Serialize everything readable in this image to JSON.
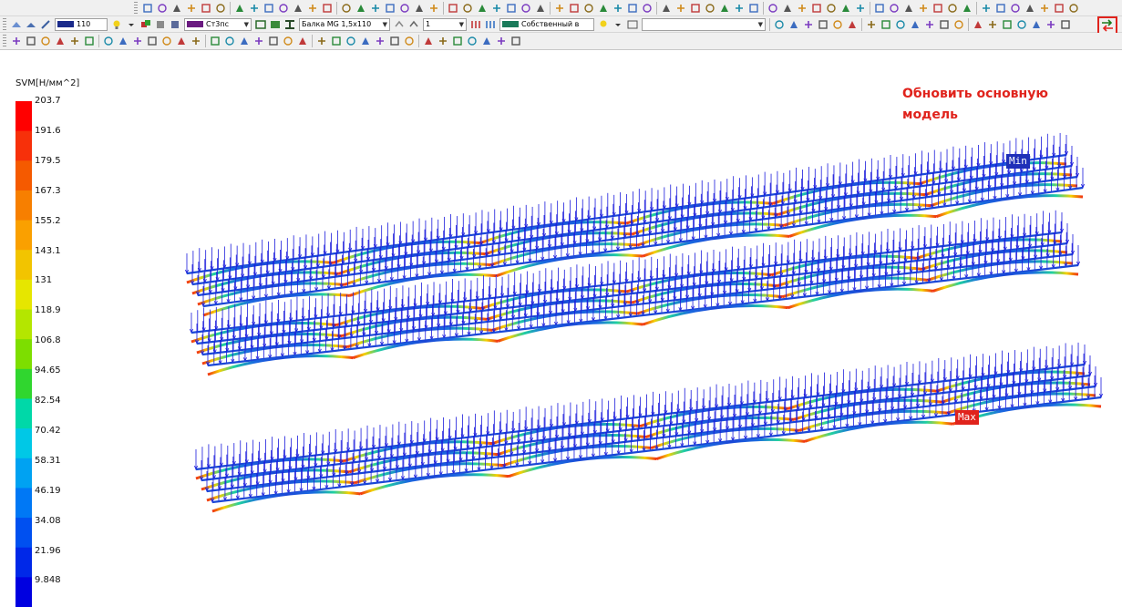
{
  "toolbar": {
    "group_number": "110",
    "material": "Ст3пс",
    "section": "Балка MG 1,5x110",
    "step": "1",
    "load_case": "Собственный в",
    "empty_combo": ""
  },
  "legend": {
    "title": "SVM[Н/мм^2]",
    "ticks": [
      "203.7",
      "191.6",
      "179.5",
      "167.3",
      "155.2",
      "143.1",
      "131",
      "118.9",
      "106.8",
      "94.65",
      "82.54",
      "70.42",
      "58.31",
      "46.19",
      "34.08",
      "21.96",
      "9.848"
    ],
    "colors": [
      "#ff0000",
      "#f7300a",
      "#f55a00",
      "#f77f00",
      "#faa000",
      "#f2c400",
      "#e6e600",
      "#b4e600",
      "#7dde00",
      "#30d62f",
      "#00d8a8",
      "#00c8e6",
      "#00a2f2",
      "#0078f5",
      "#0050f0",
      "#0028e8",
      "#0000e0"
    ]
  },
  "annotation": {
    "line1": "Обновить основную",
    "line2": "модель"
  },
  "labels": {
    "min": "Min",
    "max": "Max"
  },
  "colors": {
    "accent": "#e0231c",
    "beam_base": "#1a47d6",
    "load_arrow": "#1a1adc",
    "min_tag": "#1f2fb8",
    "max_tag": "#e0231c",
    "toolbar_bg": "#f0f0f0"
  },
  "icons": {
    "refresh": "swap-arrows-icon"
  }
}
